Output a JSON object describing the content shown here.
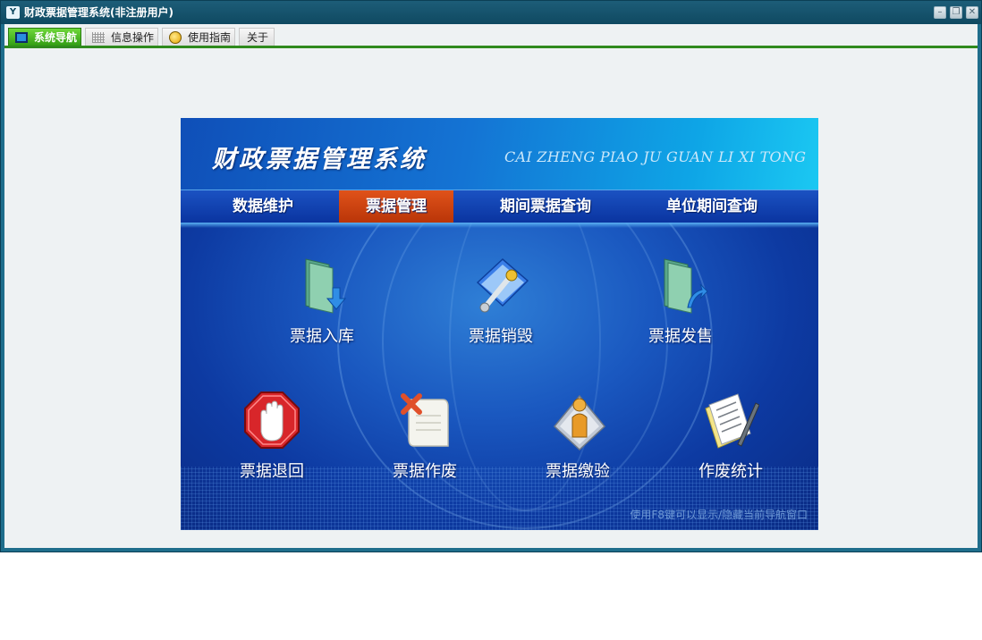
{
  "window": {
    "title": "财政票据管理系统(非注册用户)",
    "icon": "app-logo-icon"
  },
  "tabs": [
    {
      "label": "系统导航",
      "icon": "monitor-icon",
      "active": true
    },
    {
      "label": "信息操作",
      "icon": "grid-icon",
      "active": false
    },
    {
      "label": "使用指南",
      "icon": "help-icon",
      "active": false
    },
    {
      "label": "关于",
      "icon": "",
      "active": false
    }
  ],
  "panel": {
    "title": "财政票据管理系统",
    "subtitle": "CAI ZHENG PIAO JU GUAN LI XI TONG",
    "menu": [
      {
        "label": "数据维护",
        "active": false
      },
      {
        "label": "票据管理",
        "active": true
      },
      {
        "label": "期间票据查询",
        "active": false
      },
      {
        "label": "单位期间查询",
        "active": false
      }
    ],
    "actions": [
      {
        "label": "票据入库",
        "icon": "folder-download-icon"
      },
      {
        "label": "票据销毁",
        "icon": "wrench-book-icon"
      },
      {
        "label": "票据发售",
        "icon": "folder-upload-icon"
      },
      {
        "label": "票据退回",
        "icon": "stop-hand-icon"
      },
      {
        "label": "票据作废",
        "icon": "document-cancel-icon"
      },
      {
        "label": "票据缴验",
        "icon": "user-badge-icon"
      },
      {
        "label": "作废统计",
        "icon": "document-pen-icon"
      }
    ],
    "hint": "使用F8键可以显示/隐藏当前导航窗口"
  },
  "colors": {
    "active_tab": "#3aa81a",
    "active_menu": "#d0440f",
    "panel_blue": "#1a58c0"
  }
}
